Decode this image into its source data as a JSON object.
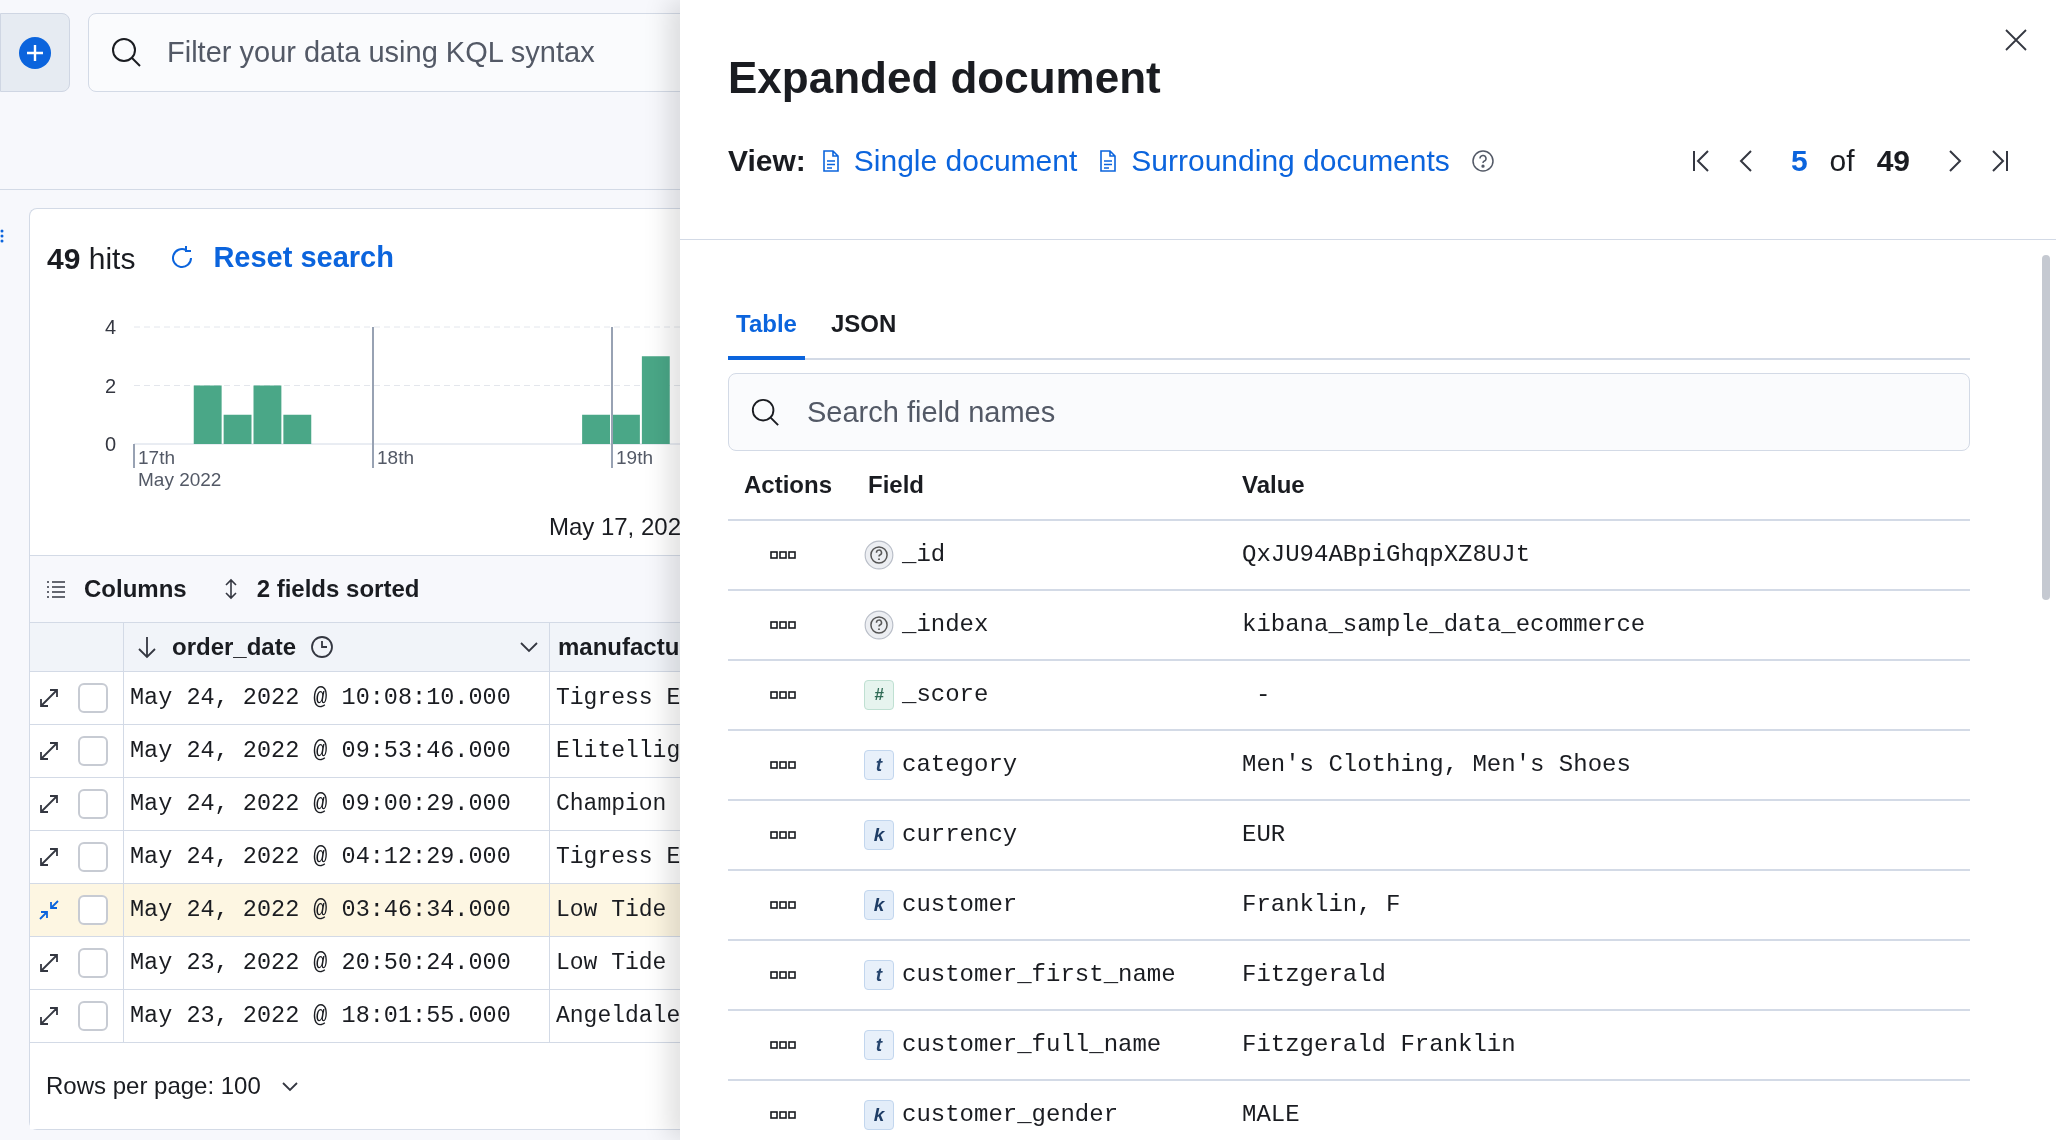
{
  "query_bar": {
    "placeholder": "Filter your data using KQL syntax"
  },
  "hits": {
    "text": "**49** hits",
    "reset_label": "Reset search"
  },
  "histogram": {
    "x_sublabel": "May 2022",
    "chart_data": {
      "type": "bar",
      "categories": [
        "17th",
        null,
        null,
        null,
        null,
        null,
        null,
        null,
        "18th",
        null,
        null,
        null,
        null,
        null,
        null,
        null,
        "19th",
        null,
        null
      ],
      "values": [
        null,
        null,
        2,
        1,
        2,
        1,
        null,
        null,
        null,
        null,
        null,
        null,
        null,
        null,
        null,
        1,
        1,
        3,
        null
      ],
      "ylim": [
        0,
        4
      ],
      "yticks": [
        0,
        2,
        4
      ],
      "xlabel": "May 17, 202"
    }
  },
  "grid_toolbar": {
    "columns_label": "Columns",
    "sort_label": "2 fields sorted"
  },
  "grid": {
    "columns": [
      "order_date",
      "manufactu"
    ],
    "rows": [
      {
        "order_date": "May 24, 2022 @ 10:08:10.000",
        "column_2": "Tigress E",
        "selected": false,
        "checked": false
      },
      {
        "order_date": "May 24, 2022 @ 09:53:46.000",
        "column_2": "Elitellig",
        "selected": false,
        "checked": false
      },
      {
        "order_date": "May 24, 2022 @ 09:00:29.000",
        "column_2": "Champion",
        "selected": false,
        "checked": false
      },
      {
        "order_date": "May 24, 2022 @ 04:12:29.000",
        "column_2": "Tigress E",
        "selected": false,
        "checked": false
      },
      {
        "order_date": "May 24, 2022 @ 03:46:34.000",
        "column_2": "Low Tide",
        "selected": true,
        "checked": false
      },
      {
        "order_date": "May 23, 2022 @ 20:50:24.000",
        "column_2": "Low Tide",
        "selected": false,
        "checked": false
      },
      {
        "order_date": "May 23, 2022 @ 18:01:55.000",
        "column_2": "Angeldale",
        "selected": false,
        "checked": false
      }
    ]
  },
  "rows_per_page": "Rows per page: 100",
  "flyout": {
    "title": "Expanded document",
    "view_label": "View:",
    "views": [
      {
        "label": "Single document"
      },
      {
        "label": "Surrounding documents"
      }
    ],
    "pagination": {
      "current": "5",
      "of": "of",
      "total": "49"
    },
    "tabs": [
      {
        "label": "Table",
        "selected": true
      },
      {
        "label": "JSON",
        "selected": false
      }
    ],
    "search": {
      "placeholder": "Search field names"
    },
    "columns": [
      "Actions",
      "Field",
      "Value"
    ],
    "fields": [
      {
        "kind": "unknown",
        "name": "_id",
        "value": "QxJU94ABpiGhqpXZ8UJt"
      },
      {
        "kind": "unknown",
        "name": "_index",
        "value": "kibana_sample_data_ecommerce"
      },
      {
        "kind": "number",
        "badge": "#",
        "name": "_score",
        "value": "-"
      },
      {
        "kind": "text",
        "badge": "t",
        "name": "category",
        "value": "Men's Clothing, Men's Shoes"
      },
      {
        "kind": "keyword",
        "badge": "k",
        "name": "currency",
        "value": "EUR"
      },
      {
        "kind": "keyword",
        "badge": "k",
        "name": "customer",
        "value": "Franklin, F"
      },
      {
        "kind": "text",
        "badge": "t",
        "name": "customer_first_name",
        "value": "Fitzgerald"
      },
      {
        "kind": "text",
        "badge": "t",
        "name": "customer_full_name",
        "value": "Fitzgerald Franklin"
      },
      {
        "kind": "keyword",
        "badge": "k",
        "name": "customer_gender",
        "value": "MALE"
      }
    ]
  }
}
